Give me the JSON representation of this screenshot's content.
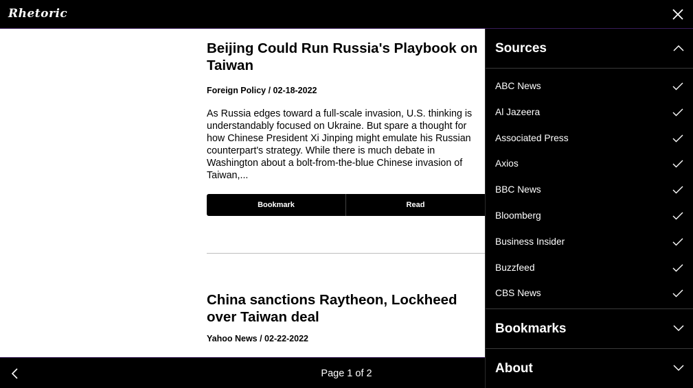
{
  "header": {
    "logo": "Rhetoric"
  },
  "articles": [
    {
      "title": "Beijing Could Run Russia's Playbook on Taiwan",
      "meta": "Foreign Policy / 02-18-2022",
      "summary": "As Russia edges toward a full-scale invasion, U.S. thinking is understandably focused on Ukraine. But spare a thought for how Chinese President Xi Jinping might emulate his Russian counterpart's strategy. While there is much debate in Washington about a bolt-from-the-blue Chinese invasion of Taiwan,...",
      "bookmark_label": "Bookmark",
      "read_label": "Read"
    },
    {
      "title": "China sanctions Raytheon, Lockheed over Taiwan deal",
      "meta": "Yahoo News / 02-22-2022"
    }
  ],
  "footer": {
    "page_indicator": "Page 1 of 2"
  },
  "sidebar": {
    "sources_title": "Sources",
    "sources": [
      "ABC News",
      "Al Jazeera",
      "Associated Press",
      "Axios",
      "BBC News",
      "Bloomberg",
      "Business Insider",
      "Buzzfeed",
      "CBS News"
    ],
    "bookmarks_title": "Bookmarks",
    "about_title": "About"
  },
  "icons": {
    "close": "close-icon",
    "prev": "chevron-left-icon",
    "chevron_up": "chevron-up-icon",
    "chevron_down": "chevron-down-icon",
    "check": "check-icon"
  },
  "colors": {
    "background": "#000000",
    "accent": "#3a1c5c",
    "text": "#ffffff"
  }
}
